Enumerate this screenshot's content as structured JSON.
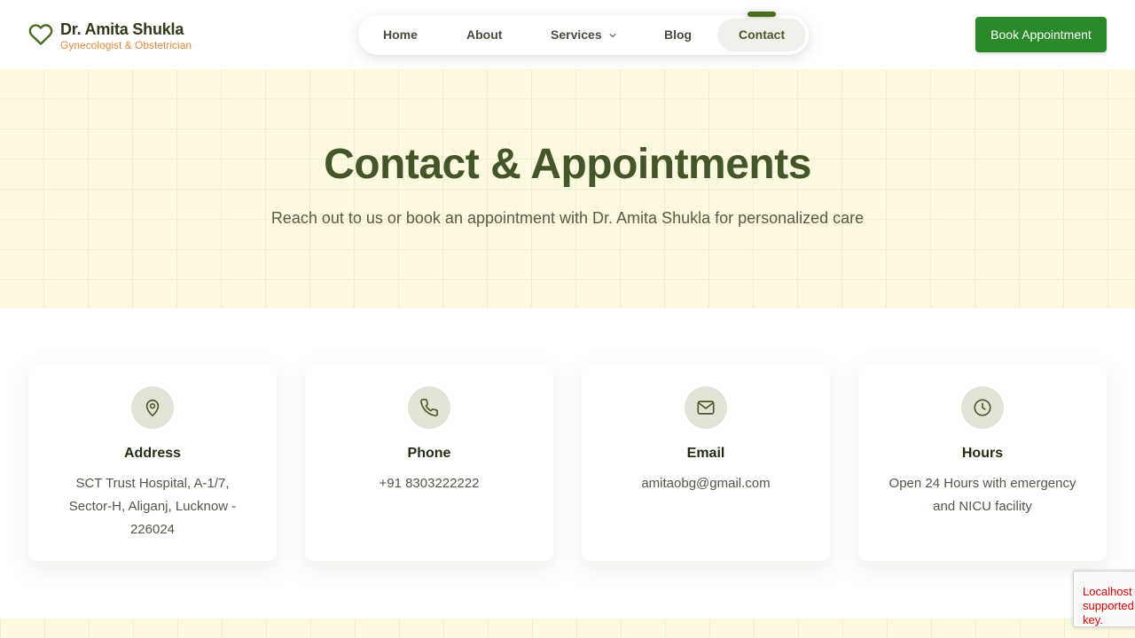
{
  "brand": {
    "name": "Dr. Amita Shukla",
    "subtitle": "Gynecologist & Obstetrician"
  },
  "nav": {
    "items": [
      {
        "label": "Home"
      },
      {
        "label": "About"
      },
      {
        "label": "Services"
      },
      {
        "label": "Blog"
      },
      {
        "label": "Contact"
      }
    ],
    "active": "Contact"
  },
  "header": {
    "book_label": "Book Appointment"
  },
  "hero": {
    "title": "Contact & Appointments",
    "subtitle": "Reach out to us or book an appointment with Dr. Amita Shukla for personalized care"
  },
  "cards": [
    {
      "icon": "map-pin-icon",
      "title": "Address",
      "text": "SCT Trust Hospital, A-1/7, Sector-H, Aliganj, Lucknow - 226024"
    },
    {
      "icon": "phone-icon",
      "title": "Phone",
      "text": "+91 8303222222"
    },
    {
      "icon": "mail-icon",
      "title": "Email",
      "text": "amitaobg@gmail.com"
    },
    {
      "icon": "clock-icon",
      "title": "Hours",
      "text": "Open 24 Hours with emergency and NICU facility"
    }
  ],
  "recaptcha": {
    "text": "Localhost is not in the list of supported domains for this site key."
  },
  "colors": {
    "brand_green": "#2a8a2a",
    "title_green": "#44552a",
    "accent_orange": "#e08a3c",
    "hero_bg": "#fdf8e0"
  }
}
